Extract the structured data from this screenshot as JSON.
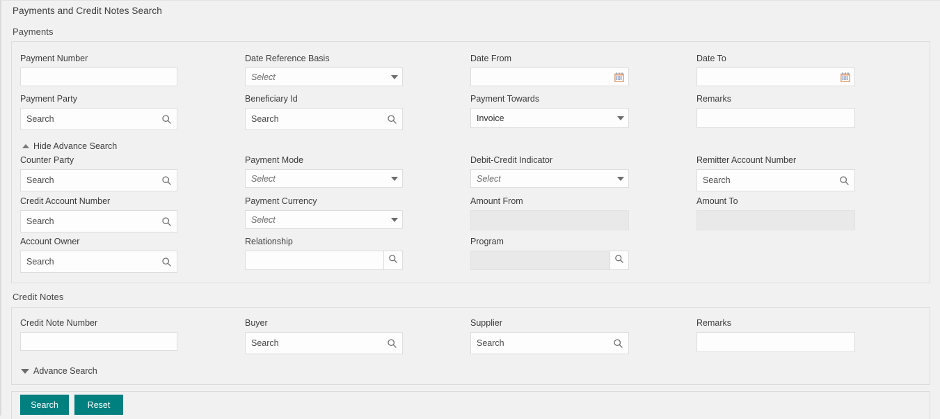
{
  "theme": {
    "accent": "#00807f",
    "page_bg": "#f1f1f1",
    "input_bg": "#fdfdfd",
    "disabled_bg": "#e9e9e9",
    "border": "#dcdcdc"
  },
  "page": {
    "title": "Payments and Credit Notes Search"
  },
  "payments_section": {
    "label": "Payments",
    "fields": {
      "payment_number": {
        "label": "Payment Number",
        "value": ""
      },
      "date_reference_basis": {
        "label": "Date Reference Basis",
        "value": "Select",
        "is_placeholder": true
      },
      "date_from": {
        "label": "Date From",
        "value": "",
        "icon": "calendar-icon"
      },
      "date_to": {
        "label": "Date To",
        "value": "",
        "icon": "calendar-icon"
      },
      "payment_party": {
        "label": "Payment Party",
        "placeholder": "Search",
        "value": "",
        "icon": "search-icon"
      },
      "beneficiary_id": {
        "label": "Beneficiary Id",
        "placeholder": "Search",
        "value": "",
        "icon": "search-icon"
      },
      "payment_towards": {
        "label": "Payment Towards",
        "value": "Invoice",
        "is_placeholder": false
      },
      "remarks": {
        "label": "Remarks",
        "value": ""
      }
    },
    "advance_toggle": {
      "label": "Hide Advance Search",
      "state": "expanded",
      "icon": "chevron-up-icon"
    },
    "advance_fields": {
      "counter_party": {
        "label": "Counter Party",
        "placeholder": "Search",
        "value": "",
        "icon": "search-icon"
      },
      "payment_mode": {
        "label": "Payment Mode",
        "value": "Select",
        "is_placeholder": true
      },
      "debit_credit_indicator": {
        "label": "Debit-Credit Indicator",
        "value": "Select",
        "is_placeholder": true
      },
      "remitter_account_number": {
        "label": "Remitter Account Number",
        "placeholder": "Search",
        "value": "",
        "icon": "search-icon"
      },
      "credit_account_number": {
        "label": "Credit Account Number",
        "placeholder": "Search",
        "value": "",
        "icon": "search-icon"
      },
      "payment_currency": {
        "label": "Payment Currency",
        "value": "Select",
        "is_placeholder": true
      },
      "amount_from": {
        "label": "Amount From",
        "value": "",
        "disabled": true
      },
      "amount_to": {
        "label": "Amount To",
        "value": "",
        "disabled": true
      },
      "account_owner": {
        "label": "Account Owner",
        "placeholder": "Search",
        "value": "",
        "icon": "search-icon"
      },
      "relationship": {
        "label": "Relationship",
        "value": "",
        "icon": "search-icon"
      },
      "program": {
        "label": "Program",
        "value": "",
        "disabled": true,
        "icon": "search-icon"
      }
    }
  },
  "credit_notes_section": {
    "label": "Credit Notes",
    "fields": {
      "credit_note_number": {
        "label": "Credit Note Number",
        "value": ""
      },
      "buyer": {
        "label": "Buyer",
        "placeholder": "Search",
        "value": "",
        "icon": "search-icon"
      },
      "supplier": {
        "label": "Supplier",
        "placeholder": "Search",
        "value": "",
        "icon": "search-icon"
      },
      "remarks": {
        "label": "Remarks",
        "value": ""
      }
    },
    "advance_toggle": {
      "label": "Advance Search",
      "state": "collapsed",
      "icon": "chevron-down-icon"
    }
  },
  "actions": {
    "search_label": "Search",
    "reset_label": "Reset"
  }
}
